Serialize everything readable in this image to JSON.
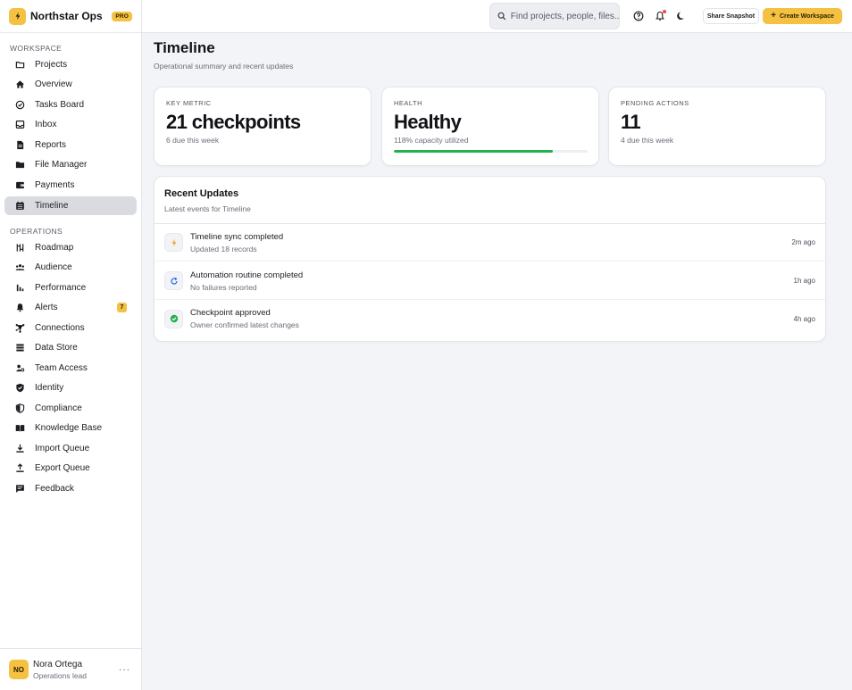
{
  "brand": {
    "name": "Northstar Ops",
    "badge": "PRO"
  },
  "sidebar": {
    "workspace_label": "WORKSPACE",
    "workspace_items": [
      {
        "label": "Projects",
        "icon": "folder-icon"
      },
      {
        "label": "Overview",
        "icon": "home-icon"
      },
      {
        "label": "Tasks Board",
        "icon": "check-circle-icon"
      },
      {
        "label": "Inbox",
        "icon": "inbox-icon"
      },
      {
        "label": "Reports",
        "icon": "document-icon"
      },
      {
        "label": "File Manager",
        "icon": "folder-filled-icon"
      },
      {
        "label": "Payments",
        "icon": "wallet-icon"
      },
      {
        "label": "Timeline",
        "icon": "calendar-icon",
        "active": true
      }
    ],
    "operations_label": "OPERATIONS",
    "operations_items": [
      {
        "label": "Roadmap",
        "icon": "roadmap-icon"
      },
      {
        "label": "Audience",
        "icon": "users-icon"
      },
      {
        "label": "Performance",
        "icon": "bar-chart-icon"
      },
      {
        "label": "Alerts",
        "icon": "bell-icon",
        "badge": "7"
      },
      {
        "label": "Connections",
        "icon": "network-icon"
      },
      {
        "label": "Data Store",
        "icon": "database-icon"
      },
      {
        "label": "Team Access",
        "icon": "user-key-icon"
      },
      {
        "label": "Identity",
        "icon": "shield-check-icon"
      },
      {
        "label": "Compliance",
        "icon": "shield-half-icon"
      },
      {
        "label": "Knowledge Base",
        "icon": "book-icon"
      },
      {
        "label": "Import Queue",
        "icon": "download-icon"
      },
      {
        "label": "Export Queue",
        "icon": "upload-icon"
      },
      {
        "label": "Feedback",
        "icon": "chat-icon"
      }
    ],
    "user": {
      "initials": "NO",
      "name": "Nora Ortega",
      "role": "Operations lead",
      "more": "···"
    }
  },
  "topbar": {
    "search_placeholder": "Find projects, people, files...",
    "share_label": "Share Snapshot",
    "create_label": "Create Workspace"
  },
  "page": {
    "title": "Timeline",
    "subtitle": "Operational summary and recent updates"
  },
  "cards": [
    {
      "label": "KEY METRIC",
      "value": "21 checkpoints",
      "note": "6 due this week"
    },
    {
      "label": "HEALTH",
      "value": "Healthy",
      "note": "118% capacity utilized",
      "progress": 0.82
    },
    {
      "label": "PENDING ACTIONS",
      "value": "11",
      "note": "4 due this week"
    }
  ],
  "updates": {
    "title": "Recent Updates",
    "subtitle": "Latest events for Timeline",
    "rows": [
      {
        "title": "Timeline sync completed",
        "desc": "Updated 18 records",
        "time": "2m ago",
        "icon": "bolt-icon"
      },
      {
        "title": "Automation routine completed",
        "desc": "No failures reported",
        "time": "1h ago",
        "icon": "refresh-icon"
      },
      {
        "title": "Checkpoint approved",
        "desc": "Owner confirmed latest changes",
        "time": "4h ago",
        "icon": "check-badge-icon"
      }
    ]
  },
  "colors": {
    "accent": "#f4c143",
    "success": "#22b14c",
    "notification": "#ef4a3c"
  }
}
